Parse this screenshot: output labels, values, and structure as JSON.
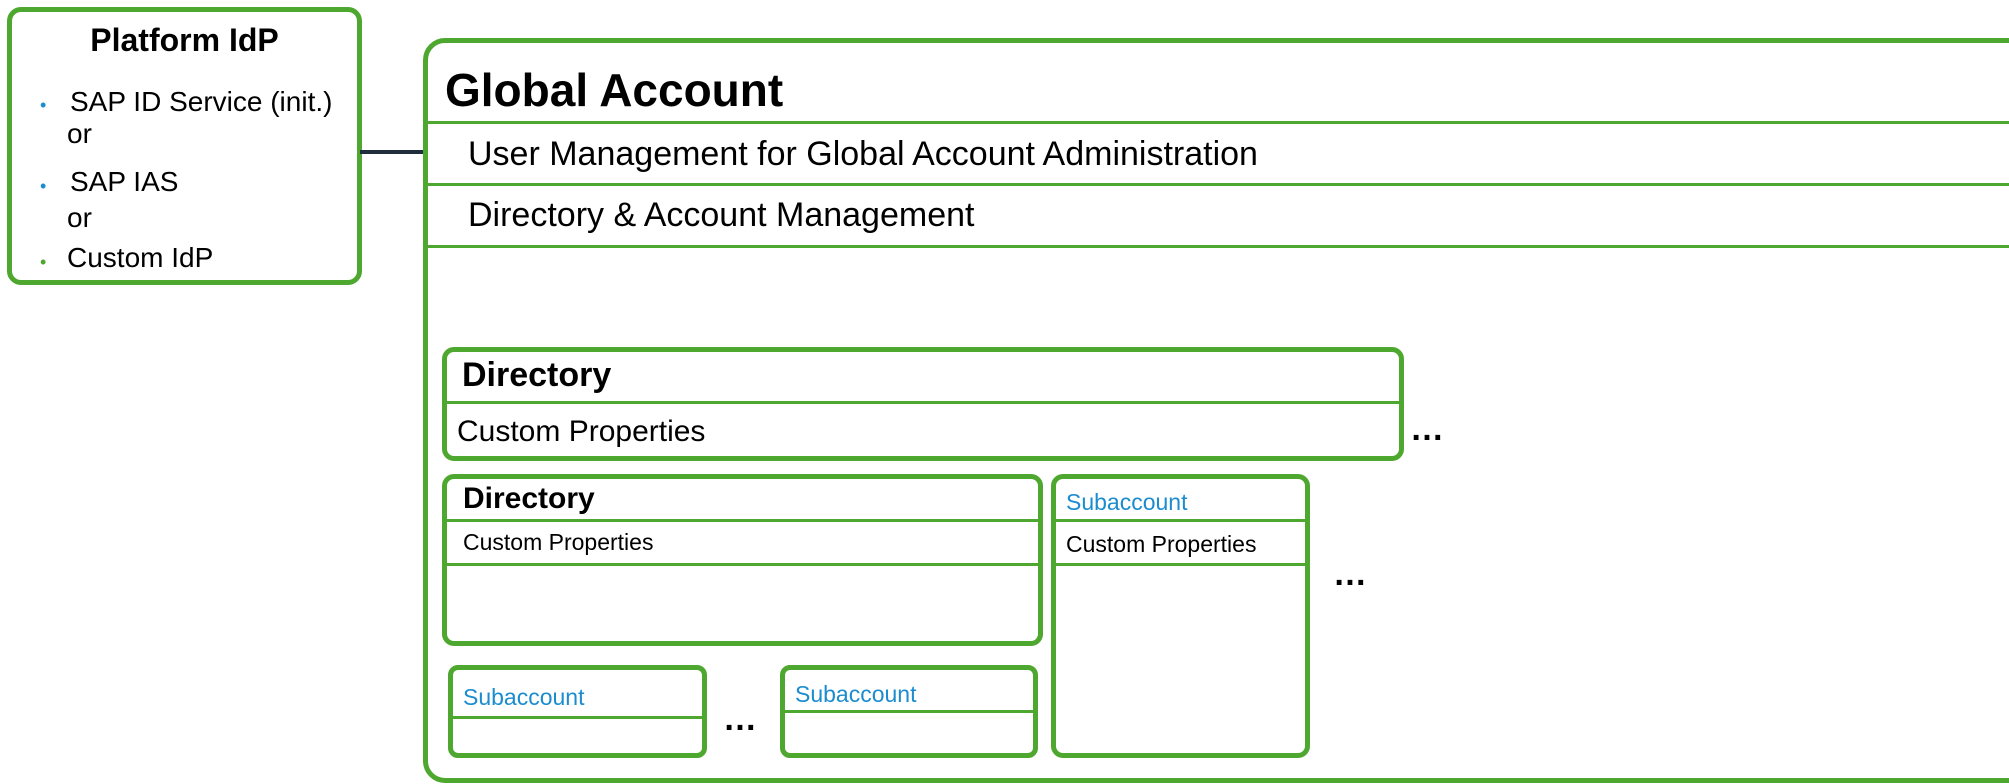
{
  "colors": {
    "border": "#4ea72e",
    "accent_text": "#1b8ccf",
    "arrow": "#1f2d3d",
    "bullet_blue": "#1b8ccf",
    "bullet_green": "#4ea72e"
  },
  "platform_idp": {
    "title": "Platform IdP",
    "items": [
      {
        "text": "SAP ID Service (init.)",
        "bullet_color": "blue"
      },
      {
        "text": "or",
        "bullet_color": null
      },
      {
        "text": "SAP IAS",
        "bullet_color": "blue"
      },
      {
        "text": "or",
        "bullet_color": null
      },
      {
        "text": "Custom IdP",
        "bullet_color": "green"
      }
    ],
    "bullet_glyph": "•"
  },
  "global_account": {
    "title": "Global Account",
    "rows": [
      "User Management for Global Account Administration",
      "Directory & Account Management"
    ]
  },
  "directory_outer": {
    "title": "Directory",
    "properties": "Custom Properties"
  },
  "directory_inner": {
    "title": "Directory",
    "properties": "Custom Properties"
  },
  "subaccount_right": {
    "title": "Subaccount",
    "properties": "Custom Properties"
  },
  "subaccount_a": {
    "title": "Subaccount"
  },
  "subaccount_b": {
    "title": "Subaccount"
  },
  "ellipsis": "…"
}
